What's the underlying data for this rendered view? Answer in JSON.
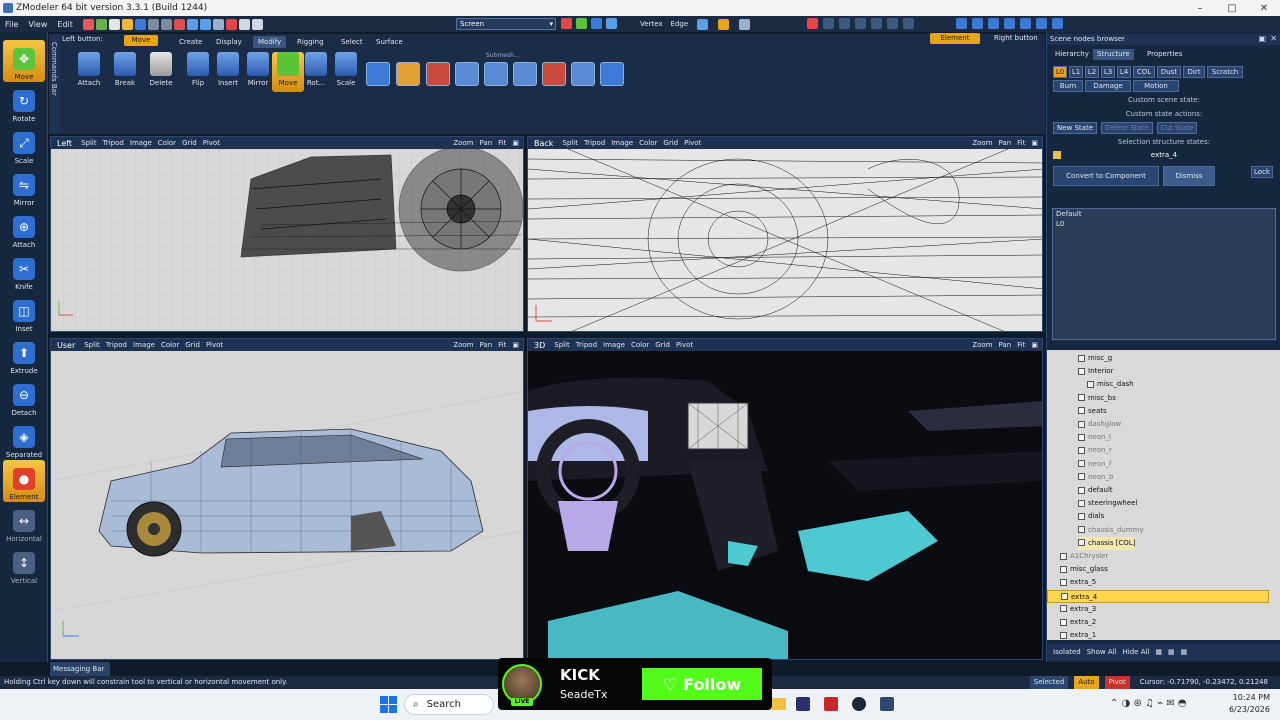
{
  "window": {
    "title": "ZModeler 64 bit version 3.3.1 (Build 1244)",
    "controls": [
      "–",
      "□",
      "✕"
    ]
  },
  "menu": [
    "File",
    "View",
    "Edit"
  ],
  "toolbar": {
    "screen_select": "Screen",
    "vertex_label": "Vertex",
    "edge_label": "Edge"
  },
  "left_tools": [
    {
      "label": "Move",
      "active": true,
      "color": "#5cc43a"
    },
    {
      "label": "Rotate",
      "color": "#2f6fd1"
    },
    {
      "label": "Scale",
      "color": "#2f6fd1"
    },
    {
      "label": "Mirror",
      "color": "#2f6fd1"
    },
    {
      "label": "Attach",
      "color": "#2f6fd1"
    },
    {
      "label": "Knife",
      "color": "#2f6fd1"
    },
    {
      "label": "Inset",
      "color": "#2f6fd1"
    },
    {
      "label": "Extrude",
      "color": "#2f6fd1"
    },
    {
      "label": "Detach",
      "color": "#2f6fd1"
    },
    {
      "label": "Separated",
      "color": "#2f6fd1"
    },
    {
      "label": "Element",
      "active": true,
      "color": "#e0402a"
    },
    {
      "label": "Horizontal",
      "disabled": true,
      "color": "#4a6184"
    },
    {
      "label": "Vertical",
      "disabled": true,
      "color": "#4a6184"
    }
  ],
  "commands_bar": "Commands Bar",
  "ribbon": {
    "left_button_label": "Left button:",
    "left_button_value": "Move",
    "tabs": [
      "Create",
      "Display",
      "Modify",
      "Rigging",
      "Select",
      "Surface"
    ],
    "active_tab": "Modify",
    "buttons": [
      "Attach",
      "Break",
      "Delete",
      "Flip",
      "Insert",
      "Mirror",
      "Move",
      "Rot...",
      "Scale"
    ],
    "submesh_label": "Submesh..."
  },
  "viewports": [
    {
      "name": "Left",
      "items": [
        "Split",
        "Tripod",
        "Image",
        "Color",
        "Grid",
        "Pivot"
      ]
    },
    {
      "name": "Back",
      "items": [
        "Split",
        "Tripod",
        "Image",
        "Color",
        "Grid",
        "Pivot"
      ]
    },
    {
      "name": "User",
      "items": [
        "Split",
        "Tripod",
        "Image",
        "Color",
        "Grid",
        "Pivot"
      ]
    },
    {
      "name": "3D",
      "items": [
        "Split",
        "Tripod",
        "Image",
        "Color",
        "Grid",
        "Pivot"
      ]
    }
  ],
  "viewport_right": {
    "zoom": "Zoom",
    "pan": "Pan",
    "fit": "Fit"
  },
  "right_panel": {
    "mode_badge": "Element",
    "right_button": "Right button",
    "header": "Scene nodes browser",
    "tabs": [
      "Hierarchy",
      "Structure",
      "Properties"
    ],
    "active_tab": "Structure",
    "lod_buttons": [
      "L0",
      "L1",
      "L2",
      "L3",
      "L4",
      "COL",
      "Dust",
      "Dirt",
      "Scratch"
    ],
    "row2_buttons": [
      "Burn",
      "Damage",
      "Motion"
    ],
    "custom_scene_state": "Custom scene state:",
    "custom_state_actions": "Custom state actions:",
    "new_state": "New State",
    "state_btn_2": "Delete State",
    "state_btn_3": "Cut State",
    "selection_structure_states": "Selection structure states:",
    "selected_node": "extra_4",
    "convert_label": "Convert to Component",
    "dismiss_label": "Dismiss",
    "lock_label": "Lock",
    "state_list": [
      "Default",
      "L0"
    ]
  },
  "tree": [
    {
      "label": "misc_g",
      "indent": 3
    },
    {
      "label": "Interior",
      "indent": 3
    },
    {
      "label": "misc_dash",
      "indent": 4
    },
    {
      "label": "misc_bs",
      "indent": 3
    },
    {
      "label": "seats",
      "indent": 3
    },
    {
      "label": "dashglow",
      "indent": 3,
      "dim": true
    },
    {
      "label": "neon_l",
      "indent": 3,
      "dim": true
    },
    {
      "label": "neon_r",
      "indent": 3,
      "dim": true
    },
    {
      "label": "neon_f",
      "indent": 3,
      "dim": true
    },
    {
      "label": "neon_b",
      "indent": 3,
      "dim": true
    },
    {
      "label": "default",
      "indent": 3
    },
    {
      "label": "steeringwheel",
      "indent": 3
    },
    {
      "label": "dials",
      "indent": 3
    },
    {
      "label": "chassis_dummy",
      "indent": 3,
      "dim": true
    },
    {
      "label": "chassis [COL]",
      "indent": 3,
      "hl": true
    },
    {
      "label": "A1Chrysler",
      "indent": 1,
      "dim": true
    },
    {
      "label": "misc_glass",
      "indent": 1
    },
    {
      "label": "extra_5",
      "indent": 1
    },
    {
      "label": "extra_4",
      "indent": 1,
      "sel": true
    },
    {
      "label": "extra_3",
      "indent": 1
    },
    {
      "label": "extra_2",
      "indent": 1
    },
    {
      "label": "extra_1",
      "indent": 1
    }
  ],
  "tree_footer": {
    "isolated": "Isolated",
    "show_all": "Show All",
    "hide_all": "Hide All"
  },
  "messaging_bar": "Messaging Bar",
  "status": {
    "hint": "Holding Ctrl key down will constrain tool to vertical or horizontal movement only.",
    "selected": "Selected",
    "auto": "Auto",
    "pivot": "Pivot",
    "cursor": "Cursor: -0.71790, -0.23472, 0.21248"
  },
  "taskbar": {
    "search": "Search",
    "time": "10:24 PM",
    "date": "6/23/2026"
  },
  "kick": {
    "logo": "KICK",
    "name": "SeadeTx",
    "live": "LIVE",
    "follow": "Follow"
  },
  "colors": {
    "accent": "#e9a51a",
    "kick_green": "#53fc18",
    "bg": "#162740"
  }
}
